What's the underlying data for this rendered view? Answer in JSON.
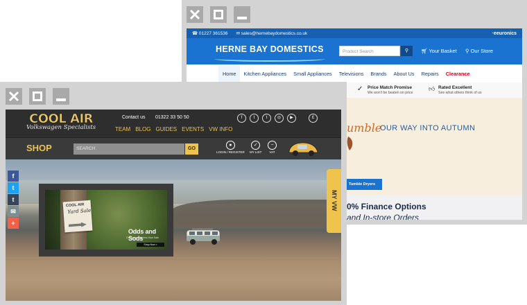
{
  "back_window": {
    "site": {
      "top_bar": {
        "phone": "01227 361536",
        "email": "sales@hernebaydomestics.co.uk",
        "partner": "euronics"
      },
      "header": {
        "logo": "HERNE BAY DOMESTICS",
        "search_placeholder": "Product Search",
        "basket": "Your Basket",
        "store": "Our Store"
      },
      "nav": [
        "Home",
        "Kitchen Appliances",
        "Small Appliances",
        "Televisions",
        "Brands",
        "About Us",
        "Repairs",
        "Clearance"
      ],
      "usps": [
        {
          "title": "Price Match Promise",
          "sub": "We won't be beaten on price"
        },
        {
          "title": "Rated Excellent",
          "sub": "See what others think of us"
        }
      ],
      "banner": {
        "script": "umble",
        "headline": "OUR WAY INTO AUTUMN",
        "button": "Tumble Dryers"
      },
      "finance": {
        "line1": "0% Finance Options",
        "line2": "and In-store Orders"
      }
    }
  },
  "front_window": {
    "site": {
      "header": {
        "logo": "COOL AIR",
        "logo_sub": "Volkswagen Specialists",
        "contact_label": "Contact us",
        "phone": "01322 33 50 50",
        "nav": [
          "TEAM",
          "BLOG",
          "GUIDES",
          "EVENTS",
          "VW INFO"
        ],
        "social": [
          "f",
          "t",
          "t",
          "◎",
          "▶"
        ],
        "currency": "£"
      },
      "shop_bar": {
        "title": "SHOP",
        "search_placeholder": "SEARCH",
        "search_button": "GO",
        "icons": [
          {
            "icon": "user-icon",
            "label": "LOGIN / REGISTER"
          },
          {
            "icon": "check-icon",
            "label": "MY LIST"
          },
          {
            "icon": "vat-icon",
            "label": "VAT"
          }
        ]
      },
      "hero": {
        "social_rail": [
          "f",
          "t",
          "t",
          "✉",
          "+"
        ],
        "promo": {
          "sign_brand": "COOL AIR",
          "sign_text": "Yard Sale",
          "title": "Odds and Sods",
          "subtitle": "Clearance and less than Sale",
          "button": "Shop Now >"
        },
        "tab": "MY VW"
      }
    }
  },
  "colors": {
    "frame": "#d3d3d3",
    "control": "#a9a9a9",
    "hbd_blue": "#1a73d0",
    "hbd_red": "#d0021b",
    "coolair_yellow": "#f0c34d",
    "coolair_dark": "#2e2e2e"
  }
}
